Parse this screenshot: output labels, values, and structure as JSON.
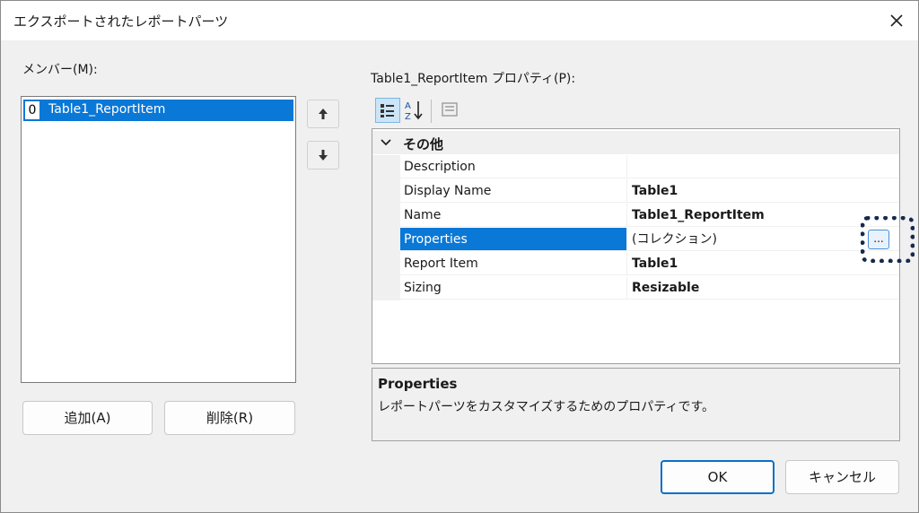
{
  "window": {
    "title": "エクスポートされたレポートパーツ",
    "close_icon": "close-icon"
  },
  "members": {
    "label": "メンバー(M):",
    "items": [
      {
        "index": "0",
        "name": "Table1_ReportItem"
      }
    ],
    "add_label": "追加(A)",
    "remove_label": "削除(R)"
  },
  "properties": {
    "label": "Table1_ReportItem プロパティ(P):",
    "category": "その他",
    "rows": [
      {
        "name": "Description",
        "value": ""
      },
      {
        "name": "Display Name",
        "value": "Table1"
      },
      {
        "name": "Name",
        "value": "Table1_ReportItem"
      },
      {
        "name": "Properties",
        "value": "(コレクション)"
      },
      {
        "name": "Report Item",
        "value": "Table1"
      },
      {
        "name": "Sizing",
        "value": "Resizable"
      }
    ],
    "ellipsis_label": "...",
    "description_title": "Properties",
    "description_text": "レポートパーツをカスタマイズするためのプロパティです。"
  },
  "footer": {
    "ok_label": "OK",
    "cancel_label": "キャンセル"
  },
  "colors": {
    "accent": "#0a78d7",
    "highlight": "#162a4c"
  }
}
